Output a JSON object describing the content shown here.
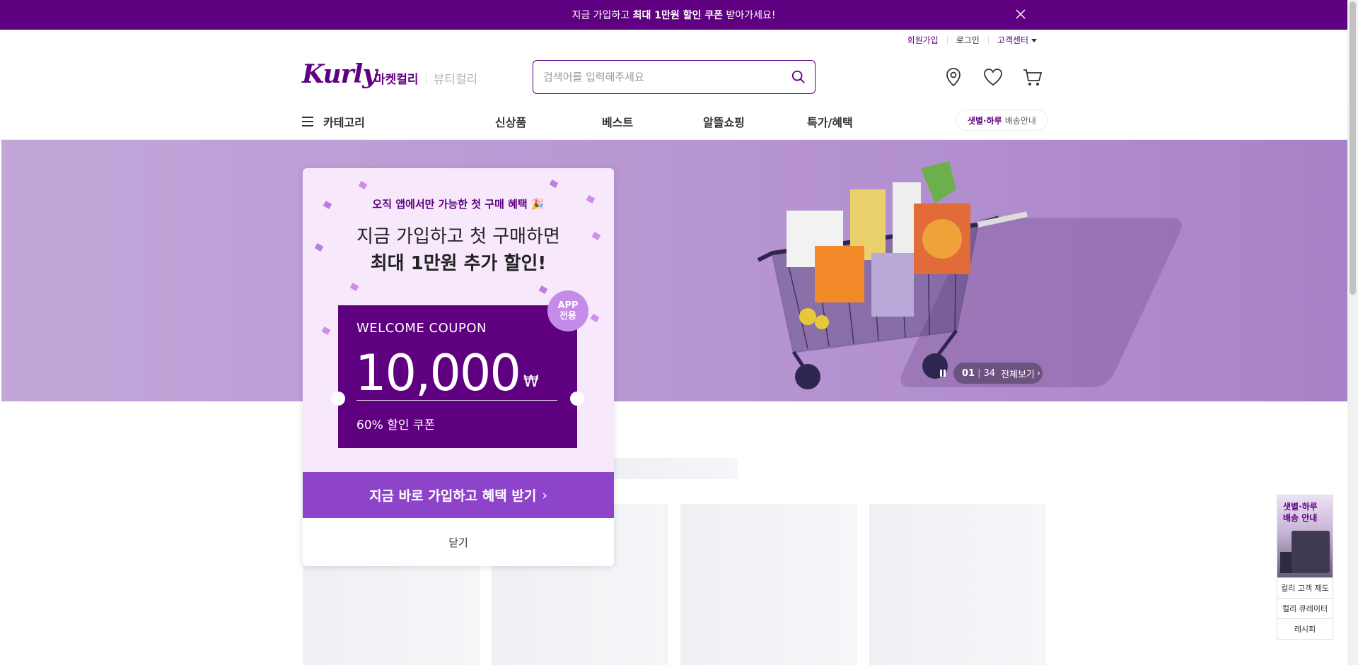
{
  "top_banner": {
    "text_before": "지금 가입하고 ",
    "text_bold": "최대 1만원 할인 쿠폰",
    "text_after": " 받아가세요!"
  },
  "utility": {
    "signup": "회원가입",
    "login": "로그인",
    "customer_center": "고객센터"
  },
  "brand": {
    "logo": "Kurly",
    "market": "마켓컬리",
    "beauty": "뷰티컬리"
  },
  "search": {
    "placeholder": "검색어를 입력해주세요"
  },
  "gnb": {
    "category": "카테고리",
    "menus": [
      "신상품",
      "베스트",
      "알뜰쇼핑",
      "특가/혜택"
    ],
    "delivery_bold": "샛별·하루",
    "delivery_text": "배송안내"
  },
  "banner": {
    "current": "01",
    "total": "34",
    "view_all": "전체보기"
  },
  "side": {
    "thumb_title_1": "샛별·하루",
    "thumb_title_2": "배송 안내",
    "links": [
      "컬리 고객 제도",
      "컬리 큐레이터",
      "레시피"
    ]
  },
  "popup": {
    "subtitle": "오직 앱에서만 가능한 첫 구매 혜택 🎉",
    "headline_1": "지금 가입하고 첫 구매하면",
    "headline_2": "최대 1만원 추가 할인!",
    "badge_line1": "APP",
    "badge_line2": "전용",
    "coupon_title": "WELCOME COUPON",
    "coupon_amount": "10,000",
    "coupon_currency": "₩",
    "coupon_desc": "60% 할인 쿠폰",
    "cta": "지금 바로 가입하고 혜택 받기",
    "close": "닫기"
  },
  "colors": {
    "brand_purple": "#5f0080",
    "cta_purple": "#8e44c9",
    "popup_bg": "#f7e9fb"
  }
}
